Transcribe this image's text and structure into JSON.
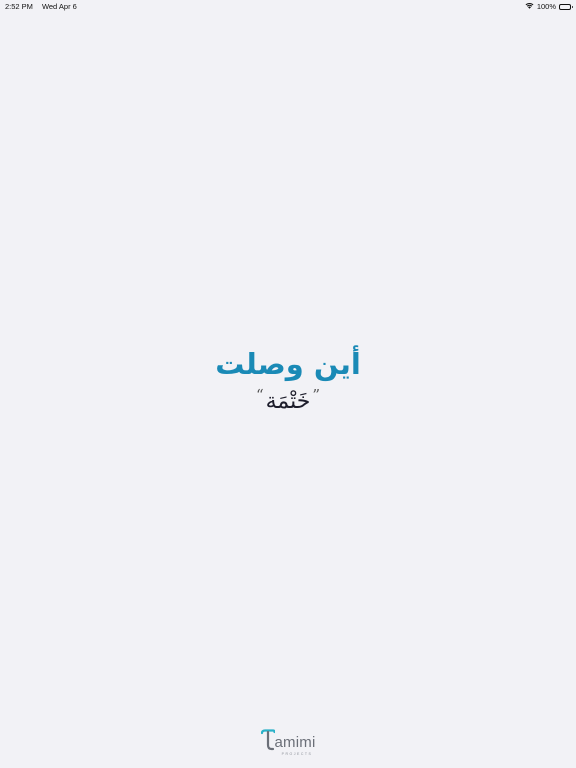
{
  "status_bar": {
    "time": "2:52 PM",
    "date": "Wed Apr 6",
    "battery": "100%",
    "battery_level": 1.0,
    "wifi_icon": "wifi-icon",
    "battery_icon": "battery-icon"
  },
  "main": {
    "headline": "أين وصلت",
    "open_quote": "“",
    "word": "خَتْمَة",
    "close_quote": "”"
  },
  "logo": {
    "name": "Tamimi",
    "wordmark": "amimi",
    "subtitle": "PROJECTS"
  },
  "colors": {
    "background": "#f2f2f6",
    "headline": "#1a8ab6",
    "accent": "#2ab1c8",
    "logo_gray": "#6b6f78"
  }
}
